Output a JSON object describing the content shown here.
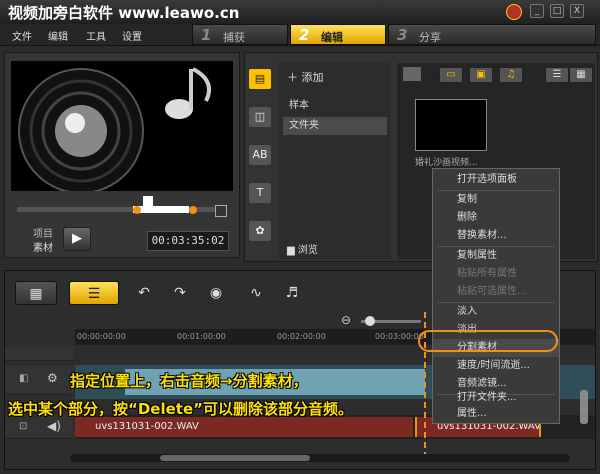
{
  "window": {
    "title": "视频加旁白软件 www.leawo.cn",
    "buttons": [
      "_",
      "□",
      "X"
    ]
  },
  "menu": [
    "文件",
    "编辑",
    "工具",
    "设置"
  ],
  "steps": [
    {
      "num": "1",
      "label": "捕获"
    },
    {
      "num": "2",
      "label": "编辑"
    },
    {
      "num": "3",
      "label": "分享"
    }
  ],
  "preview": {
    "mode_project": "项目",
    "mode_clip": "素材",
    "timecode": "00:03:35:02",
    "play": "▶"
  },
  "library": {
    "add": "添加",
    "folders": [
      "样本",
      "文件夹"
    ],
    "selected_folder": "文件夹",
    "browse": "浏览",
    "thumb_label": "婚礼沙画视频...",
    "lib_icons": [
      "media-icon",
      "transition-icon",
      "title-icon",
      "text-icon",
      "filter-icon"
    ]
  },
  "ruler": [
    "00:00:00:00",
    "00:01:00:00",
    "00:02:00:00",
    "00:03:00:00"
  ],
  "tracks": {
    "audio_clip_a": "uvs131031-002.WAV",
    "audio_clip_b": "uvs131031-002.WAV"
  },
  "context_menu": [
    {
      "label": "打开选项面板",
      "enabled": true
    },
    {
      "label": "复制",
      "enabled": true
    },
    {
      "label": "删除",
      "enabled": true
    },
    {
      "label": "替换素材...",
      "enabled": true
    },
    {
      "label": "复制属性",
      "enabled": true
    },
    {
      "label": "粘贴所有属性",
      "enabled": false
    },
    {
      "label": "粘贴可选属性...",
      "enabled": false
    },
    {
      "label": "淡入",
      "enabled": true
    },
    {
      "label": "淡出",
      "enabled": true
    },
    {
      "label": "分割素材",
      "enabled": true
    },
    {
      "label": "速度/时间流逝...",
      "enabled": true
    },
    {
      "label": "音频滤镜...",
      "enabled": true
    },
    {
      "label": "打开文件夹...",
      "enabled": true
    },
    {
      "label": "属性...",
      "enabled": true
    }
  ],
  "annotations": {
    "line1": "指定位置上，右击音频→分割素材，",
    "line2": "选中某个部分，按“Delete”可以删除该部分音频。"
  },
  "colors": {
    "accent": "#f39016",
    "active_step": "#ffc000",
    "annotation": "#ffe000"
  }
}
